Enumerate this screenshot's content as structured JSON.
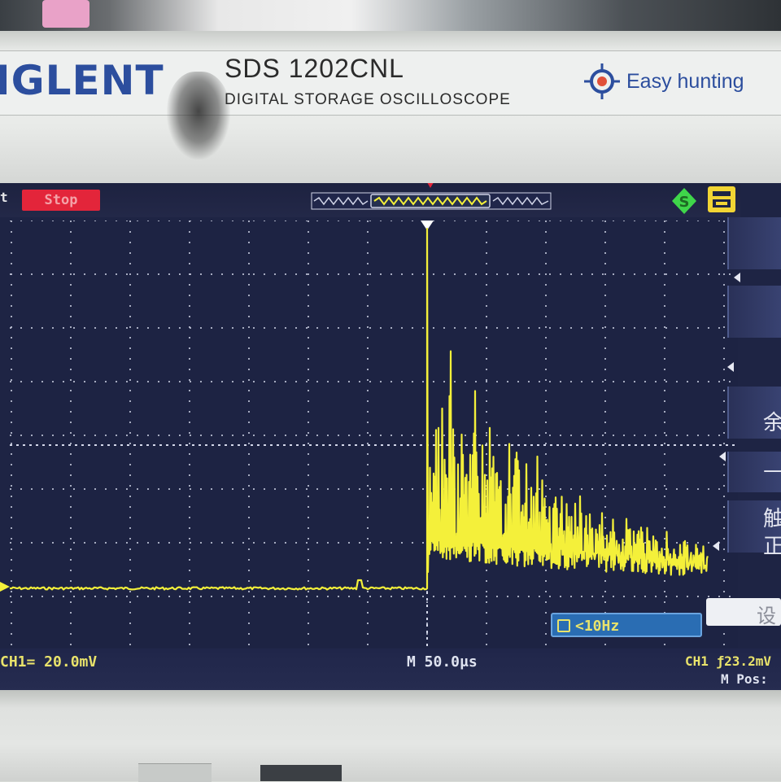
{
  "device": {
    "brand": "IGLENT",
    "brand_accent_letter": "",
    "model": "SDS 1202CNL",
    "subtitle": "DIGITAL STORAGE OSCILLOSCOPE",
    "tagline": "Easy hunting",
    "colors": {
      "brand_blue": "#2c4e9e",
      "brand_red": "#e0513a"
    }
  },
  "screen": {
    "run_letter": "t",
    "run_state": "Stop",
    "run_state_color": "#e3253a",
    "status_icons": [
      "trigger-status-icon",
      "print-icon"
    ],
    "bottom": {
      "ch1_scale": "CH1= 20.0mV",
      "timebase": "M 50.0μs",
      "trigger_level": "CH1 ƒ23.2mV",
      "m_pos": "M Pos:"
    },
    "frequency_readout": "<10Hz",
    "trace_color": "#f4f03a",
    "side_menu": [
      {
        "label": ""
      },
      {
        "label": ""
      },
      {
        "label": "余"
      },
      {
        "label": "—"
      },
      {
        "label": "触"
      },
      {
        "label": "正"
      },
      {
        "label": "设"
      }
    ]
  },
  "waveform": {
    "ch1_volts_per_div": "20.0mV",
    "time_per_div": "50.0μs",
    "baseline_divisions_above_center": -2.6,
    "trigger_time_div": 0
  }
}
